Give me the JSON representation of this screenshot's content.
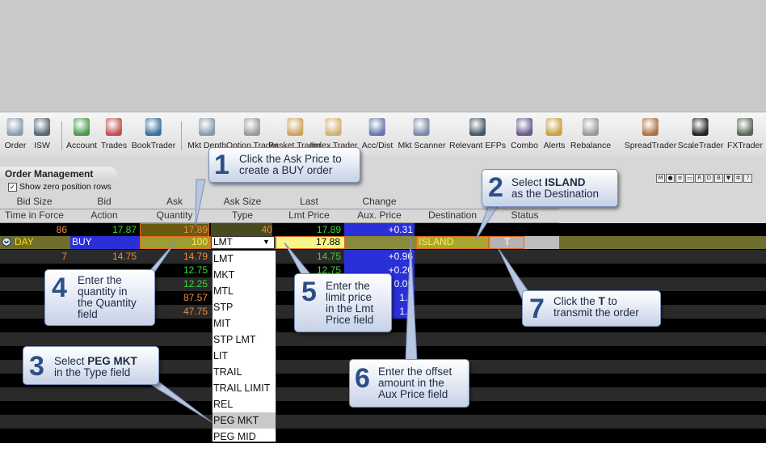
{
  "toolbar": {
    "items": [
      {
        "label": "Order",
        "icon": "order-icon"
      },
      {
        "label": "ISW",
        "icon": "isw-icon"
      },
      {
        "label": "Account",
        "icon": "account-icon"
      },
      {
        "label": "Trades",
        "icon": "trades-icon"
      },
      {
        "label": "BookTrader",
        "icon": "booktrader-icon"
      },
      {
        "label": "Mkt Depth",
        "icon": "mkt-depth-icon"
      },
      {
        "label": "Option Trader",
        "icon": "option-trader-icon"
      },
      {
        "label": "Basket Trader",
        "icon": "basket-trader-icon"
      },
      {
        "label": "Index Trader",
        "icon": "index-trader-icon"
      },
      {
        "label": "Acc/Dist",
        "icon": "acc-dist-icon"
      },
      {
        "label": "Mkt Scanner",
        "icon": "mkt-scanner-icon"
      },
      {
        "label": "Relevant EFPs",
        "icon": "efp-icon"
      },
      {
        "label": "Combo",
        "icon": "combo-icon"
      },
      {
        "label": "Alerts",
        "icon": "alerts-icon"
      },
      {
        "label": "Rebalance",
        "icon": "rebalance-icon"
      },
      {
        "label": "SpreadTrader",
        "icon": "spreadtrader-icon"
      },
      {
        "label": "ScaleTrader",
        "icon": "scaletrader-icon"
      },
      {
        "label": "FXTrader",
        "icon": "fxtrader-icon"
      }
    ]
  },
  "panel": {
    "title": "Order Management",
    "show_zero_label": "Show zero position rows",
    "show_zero_checked": true
  },
  "headers": {
    "top": [
      "Bid Size",
      "Bid",
      "Ask",
      "Ask Size",
      "Last",
      "Change"
    ],
    "bottom": [
      "Time in Force",
      "Action",
      "Quantity",
      "Type",
      "Lmt Price",
      "Aux. Price",
      "Destination",
      "Status"
    ]
  },
  "grid": {
    "quote_row": {
      "bid_size": "86",
      "bid": "17.87",
      "ask": "17.89",
      "ask_size": "40",
      "last": "17.89",
      "change": "+0.31"
    },
    "order_row": {
      "tif": "DAY",
      "action": "BUY",
      "quantity": "100",
      "type": "LMT",
      "lmt_price": "17.88",
      "destination": "ISLAND",
      "status": "T"
    },
    "rows": [
      {
        "bid_size": "7",
        "bid": "14.75",
        "ask": "14.79",
        "last": "14.75",
        "change": "+0.96"
      },
      {
        "bid_size": "",
        "bid": "",
        "ask": "12.75",
        "last": "12.75",
        "change": "+0.20"
      },
      {
        "bid_size": "",
        "bid": "",
        "ask": "12.25",
        "last": "",
        "change": "0.05"
      },
      {
        "bid_size": "",
        "bid": "",
        "ask": "87.57",
        "last": "",
        "change": "1.2"
      },
      {
        "bid_size": "",
        "bid": "",
        "ask": "47.75",
        "last": "",
        "change": "1.1"
      }
    ]
  },
  "type_dropdown": {
    "options": [
      "LMT",
      "MKT",
      "MTL",
      "STP",
      "MIT",
      "STP LMT",
      "LIT",
      "TRAIL",
      "TRAIL LIMIT",
      "REL",
      "PEG MKT",
      "PEG MID"
    ],
    "highlighted": "PEG MKT"
  },
  "callouts": [
    {
      "num": "1",
      "lines": [
        "Click the Ask Price to",
        "create a BUY order"
      ]
    },
    {
      "num": "2",
      "pre": "Select ",
      "bold": "ISLAND",
      "post": "",
      "line2": "as the Destination"
    },
    {
      "num": "3",
      "pre": "Select ",
      "bold": "PEG MKT",
      "post": "",
      "line2": "in the Type field"
    },
    {
      "num": "4",
      "lines": [
        "Enter the",
        "quantity in",
        "the Quantity",
        "field"
      ]
    },
    {
      "num": "5",
      "lines": [
        "Enter the",
        "limit price",
        "in the Lmt",
        "Price field"
      ]
    },
    {
      "num": "6",
      "lines": [
        "Enter the offset",
        "amount in the",
        "Aux Price field"
      ]
    },
    {
      "num": "7",
      "pre": "Click the ",
      "bold": "T",
      "post": " to",
      "line2": "transmit the order"
    }
  ],
  "colors": {
    "orange": "#f08a3a",
    "green": "#33dd33",
    "white": "#ffffff",
    "blue": "#2a2fd8",
    "yellow_field": "#f5f58a",
    "olive": "#777733",
    "callout_border": "#7a8fb8"
  }
}
